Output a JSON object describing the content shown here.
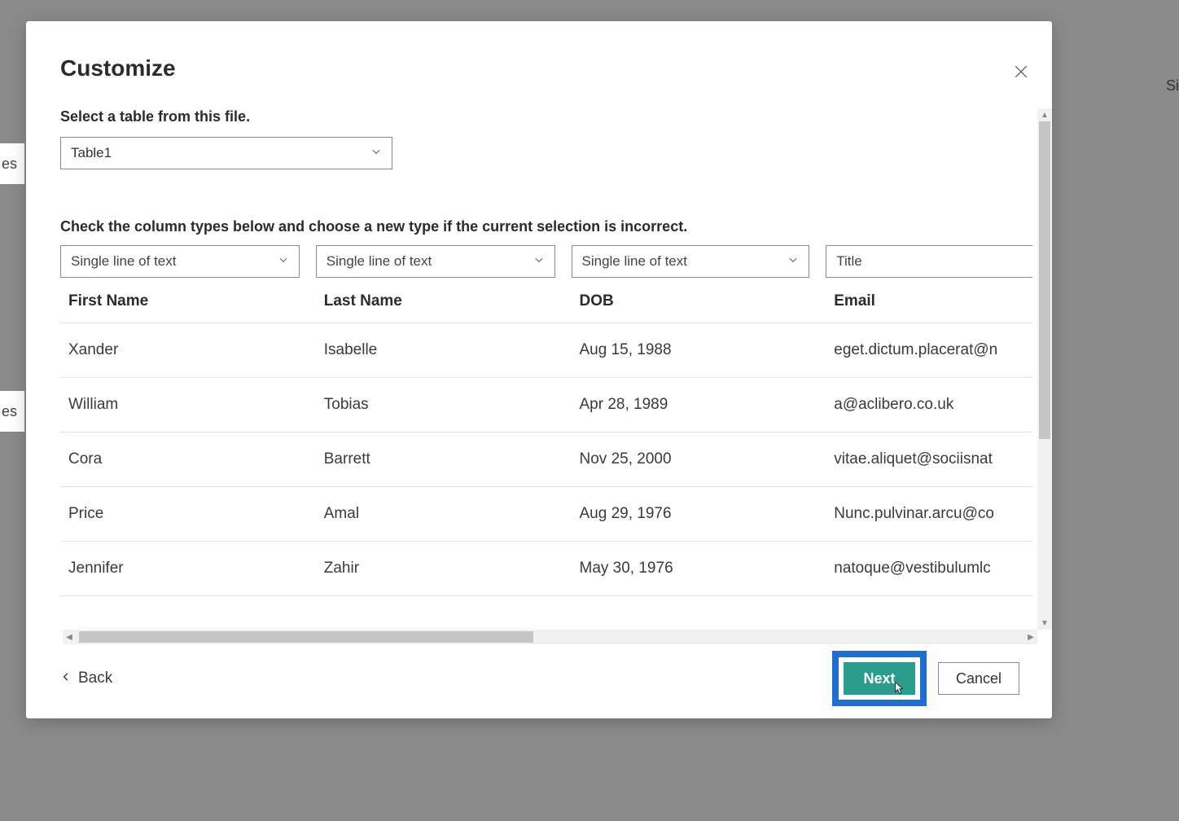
{
  "modal": {
    "title": "Customize",
    "selectTableLabel": "Select a table from this file.",
    "tableName": "Table1",
    "columnsHint": "Check the column types below and choose a new type if the current selection is incorrect.",
    "columnTypes": [
      "Single line of text",
      "Single line of text",
      "Single line of text",
      "Title"
    ],
    "headers": [
      "First Name",
      "Last Name",
      "DOB",
      "Email"
    ],
    "rows": [
      {
        "c": [
          "Xander",
          "Isabelle",
          "Aug 15, 1988",
          "eget.dictum.placerat@n"
        ]
      },
      {
        "c": [
          "William",
          "Tobias",
          "Apr 28, 1989",
          "a@aclibero.co.uk"
        ]
      },
      {
        "c": [
          "Cora",
          "Barrett",
          "Nov 25, 2000",
          "vitae.aliquet@sociisnat"
        ]
      },
      {
        "c": [
          "Price",
          "Amal",
          "Aug 29, 1976",
          "Nunc.pulvinar.arcu@co"
        ]
      },
      {
        "c": [
          "Jennifer",
          "Zahir",
          "May 30, 1976",
          "natoque@vestibulumlc"
        ]
      }
    ],
    "backLabel": "Back",
    "nextLabel": "Next",
    "cancelLabel": "Cancel"
  },
  "background": {
    "rightText": "Si",
    "leftSnippet": "es"
  }
}
